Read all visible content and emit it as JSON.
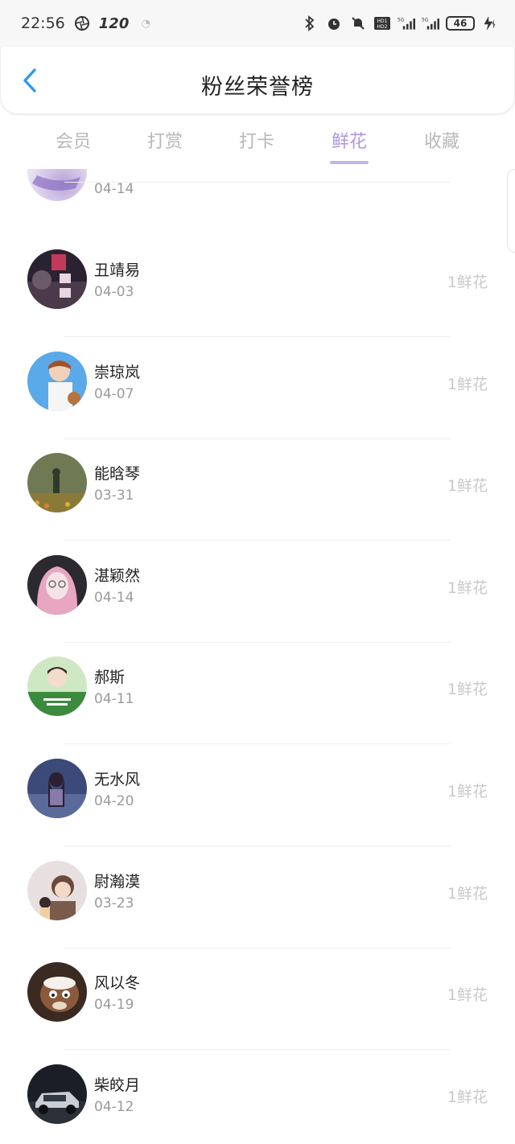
{
  "status_bar": {
    "time": "22:56",
    "refresh_rate": "120",
    "battery": "46"
  },
  "header": {
    "title": "粉丝荣誉榜"
  },
  "tabs": [
    {
      "label": "会员",
      "active": false
    },
    {
      "label": "打赏",
      "active": false
    },
    {
      "label": "打卡",
      "active": false
    },
    {
      "label": "鲜花",
      "active": true
    },
    {
      "label": "收藏",
      "active": false
    }
  ],
  "partial_row": {
    "date": "04-14"
  },
  "fans": [
    {
      "name": "丑靖易",
      "date": "04-03",
      "count": "1鲜花"
    },
    {
      "name": "崇琼岚",
      "date": "04-07",
      "count": "1鲜花"
    },
    {
      "name": "能晗琴",
      "date": "03-31",
      "count": "1鲜花"
    },
    {
      "name": "湛颖然",
      "date": "04-14",
      "count": "1鲜花"
    },
    {
      "name": "郝斯",
      "date": "04-11",
      "count": "1鲜花"
    },
    {
      "name": "无水风",
      "date": "04-20",
      "count": "1鲜花"
    },
    {
      "name": "尉瀚漠",
      "date": "03-23",
      "count": "1鲜花"
    },
    {
      "name": "风以冬",
      "date": "04-19",
      "count": "1鲜花"
    },
    {
      "name": "柴皎月",
      "date": "04-12",
      "count": "1鲜花"
    }
  ],
  "colors": {
    "accent": "#b197e0",
    "tab_inactive": "#b8b8b8",
    "back_arrow": "#2f9bea",
    "count_text": "#c9c9c9"
  }
}
